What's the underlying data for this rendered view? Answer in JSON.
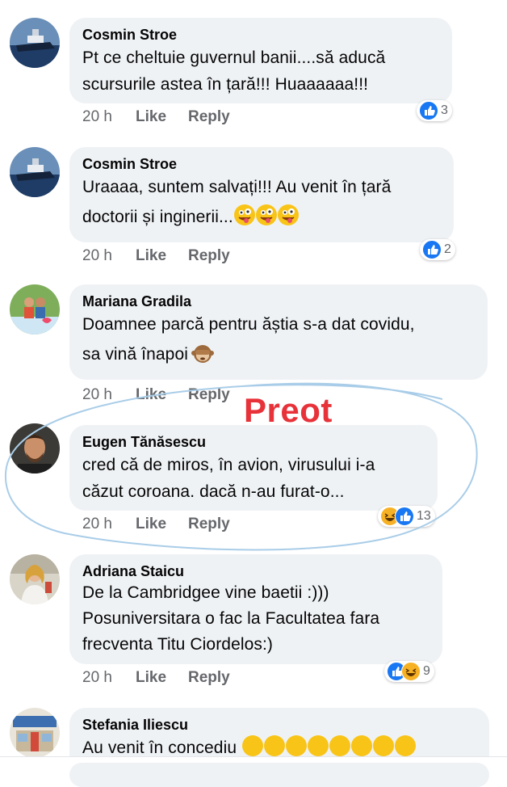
{
  "comments": [
    {
      "author": "Cosmin Stroe",
      "lines": [
        "Pt ce cheltuie guvernul banii....să aducă",
        "scursurile astea în țară!!! Huaaaaaa!!!"
      ],
      "time": "20 h",
      "like_label": "Like",
      "reply_label": "Reply",
      "reaction_count": "3",
      "reactions": [
        "like-icon"
      ]
    },
    {
      "author": "Cosmin Stroe",
      "lines": [
        "Uraaaa, suntem salvați!!! Au venit în țară",
        "doctorii și inginerii..."
      ],
      "trailing_emoji": [
        "zany-face-emoji",
        "zany-face-emoji",
        "zany-face-emoji"
      ],
      "time": "20 h",
      "like_label": "Like",
      "reply_label": "Reply",
      "reaction_count": "2",
      "reactions": [
        "like-icon"
      ]
    },
    {
      "author": "Mariana Gradila",
      "lines": [
        "Doamnee parcă pentru ăștia s-a dat covidu,",
        "sa vină înapoi"
      ],
      "trailing_emoji": [
        "see-no-evil-monkey-emoji"
      ],
      "time": "20 h",
      "like_label": "Like",
      "reply_label": "Reply"
    },
    {
      "author": "Eugen Tănăsescu",
      "lines": [
        "cred că de miros, în avion, virusului i-a",
        "căzut coroana. dacă n-au furat-o..."
      ],
      "time": "20 h",
      "like_label": "Like",
      "reply_label": "Reply",
      "reaction_count": "13",
      "reactions": [
        "haha-icon",
        "like-icon"
      ]
    },
    {
      "author": "Adriana Staicu",
      "lines": [
        "De la Cambridgee vine baetii :)))",
        "Posuniversitara o fac la Facultatea fara",
        "frecventa Titu Ciordelos:)"
      ],
      "time": "20 h",
      "like_label": "Like",
      "reply_label": "Reply",
      "reaction_count": "9",
      "reactions": [
        "like-icon",
        "haha-icon"
      ]
    },
    {
      "author": "Stefania Iliescu",
      "lines": [
        "Au venit în concediu"
      ],
      "trailing_emoji": [
        "grinning-sweat-emoji",
        "grinning-sweat-emoji",
        "grinning-sweat-emoji",
        "grinning-sweat-emoji",
        "grinning-sweat-emoji",
        "grinning-sweat-emoji",
        "grinning-sweat-emoji",
        "grinning-sweat-emoji"
      ]
    }
  ],
  "annotation": {
    "label": "Preot",
    "label_color": "#e8323a",
    "circle_color": "#a9cde8"
  },
  "colors": {
    "bubble": "#eff2f5",
    "meta_text": "#65676b",
    "like_blue": "#1877f2",
    "haha_yellow": "#f7b125"
  }
}
